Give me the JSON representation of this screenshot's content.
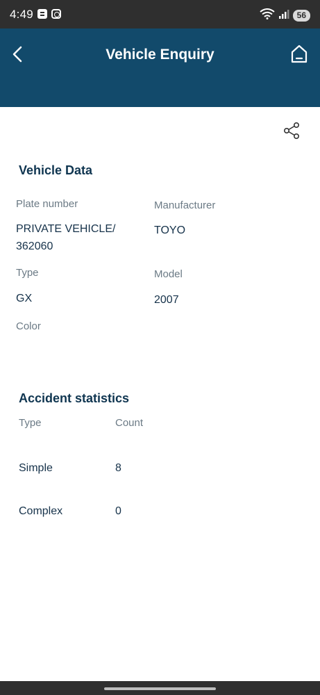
{
  "status_bar": {
    "time": "4:49",
    "battery": "56",
    "wifi_label": "6"
  },
  "header": {
    "title": "Vehicle Enquiry"
  },
  "vehicle_data": {
    "section_title": "Vehicle Data",
    "plate_label": "Plate number",
    "plate_value_line1": "PRIVATE VEHICLE/",
    "plate_value_line2": "362060",
    "manufacturer_label": "Manufacturer",
    "manufacturer_value": "TOYO",
    "type_label": "Type",
    "type_value": "GX",
    "model_label": "Model",
    "model_value": "2007",
    "color_label": "Color"
  },
  "accident_statistics": {
    "section_title": "Accident statistics",
    "columns": [
      "Type",
      "Count"
    ],
    "rows": [
      {
        "type": "Simple",
        "count": "8"
      },
      {
        "type": "Complex",
        "count": "0"
      }
    ]
  },
  "colors": {
    "app_bar": "#124a6b",
    "status_bar": "#2f2f2f",
    "title_text": "#0f3550",
    "label_text": "#6b7a85"
  }
}
